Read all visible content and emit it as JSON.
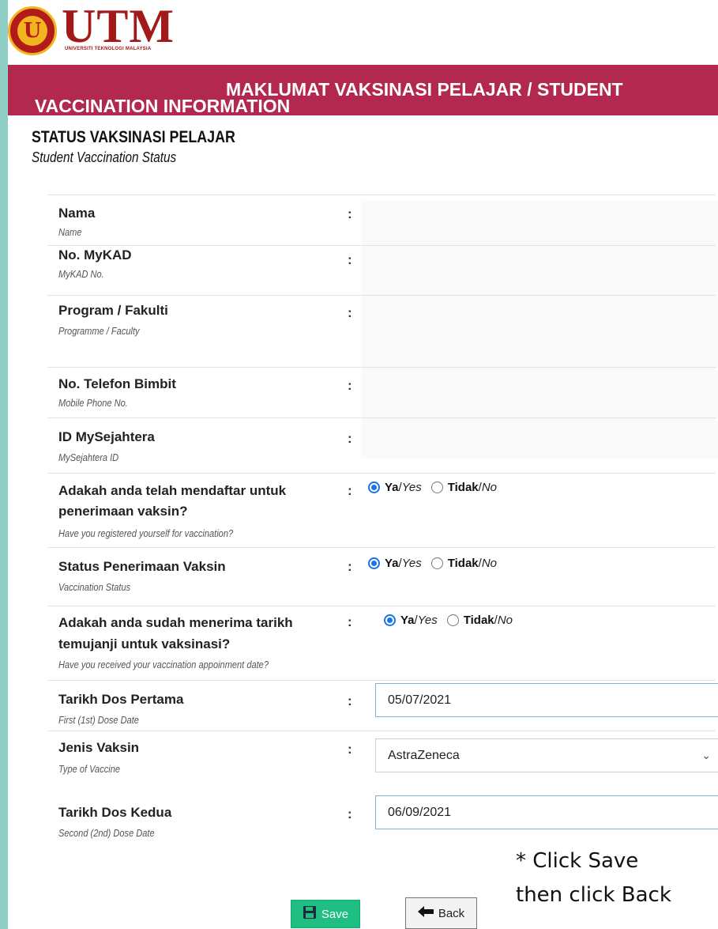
{
  "header": {
    "logo_text": "UTM",
    "logo_subtitle": "UNIVERSITI TEKNOLOGI MALAYSIA",
    "banner_line1": "MAKLUMAT VAKSINASI PELAJAR /  STUDENT",
    "banner_line2": "VACCINATION INFORMATION"
  },
  "section": {
    "title": "STATUS VAKSINASI PELAJAR",
    "subtitle": "Student Vaccination Status"
  },
  "fields": {
    "name": {
      "label": "Nama",
      "label_en": "Name",
      "colon": ":"
    },
    "mykad": {
      "label": "No. MyKAD",
      "label_en": "MyKAD No.",
      "colon": ":"
    },
    "program": {
      "label": "Program / Fakulti",
      "label_en": "Programme / Faculty",
      "colon": ":"
    },
    "phone": {
      "label": "No. Telefon Bimbit",
      "label_en": "Mobile Phone No.",
      "colon": ":"
    },
    "mysejahtera": {
      "label": "ID MySejahtera",
      "label_en": "MySejahtera ID",
      "colon": ":"
    },
    "registered": {
      "label_line1": "Adakah anda telah mendaftar untuk",
      "label_line2": "penerimaan vaksin?",
      "label_en": "Have you registered yourself for vaccination?",
      "colon": ":",
      "selected": "Ya"
    },
    "status": {
      "label": "Status Penerimaan Vaksin",
      "label_en": "Vaccination Status",
      "colon": ":",
      "selected": "Ya"
    },
    "appointment": {
      "label_line1": "Adakah anda sudah menerima tarikh",
      "label_line2": "temujanji untuk vaksinasi?",
      "label_en": "Have you received your vaccination appoinment date?",
      "colon": ":",
      "selected": "Ya"
    },
    "dose1": {
      "label": "Tarikh Dos Pertama",
      "label_en": "First (1st) Dose Date",
      "colon": ":",
      "value": "05/07/2021"
    },
    "vaccine": {
      "label": "Jenis Vaksin",
      "label_en": "Type of Vaccine",
      "colon": ":",
      "value": "AstraZeneca"
    },
    "dose2": {
      "label": "Tarikh Dos Kedua",
      "label_en": "Second (2nd) Dose Date",
      "colon": ":",
      "value": "06/09/2021"
    }
  },
  "radio_options": {
    "yes_bold": "Ya",
    "yes_sep": " / ",
    "yes_italic": "Yes",
    "no_bold": "Tidak",
    "no_sep": " / ",
    "no_italic": "No"
  },
  "note": {
    "line1": "* Click Save",
    "line2": "then click Back"
  },
  "buttons": {
    "save": "Save",
    "back": "Back"
  },
  "colors": {
    "banner": "#b2284f",
    "save_button": "#1fbf84",
    "radio_selected": "#1a73e8",
    "side_background": "#8fcfc6"
  }
}
